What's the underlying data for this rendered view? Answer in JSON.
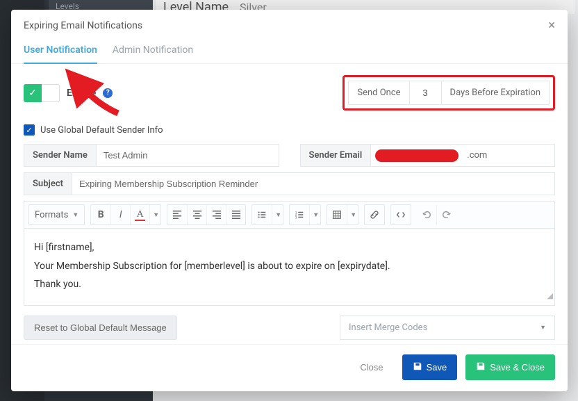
{
  "bg": {
    "levels_item": "Levels",
    "level_name_label": "Level Name",
    "level_name_value": "Silver"
  },
  "modal": {
    "title": "Expiring Email Notifications",
    "close": "×"
  },
  "tabs": {
    "user": "User Notification",
    "admin": "Admin Notification"
  },
  "enable": {
    "label": "Enable"
  },
  "send_once": {
    "label": "Send Once",
    "value": "3",
    "suffix": "Days Before Expiration"
  },
  "global_sender": {
    "checked": true,
    "label": "Use Global Default Sender Info"
  },
  "sender_name": {
    "label": "Sender Name",
    "value": "Test Admin"
  },
  "sender_email": {
    "label": "Sender Email",
    "suffix": ".com"
  },
  "subject": {
    "label": "Subject",
    "value": "Expiring Membership Subscription Reminder"
  },
  "editor": {
    "formats_label": "Formats",
    "body_line1": "Hi [firstname],",
    "body_line2": "Your Membership Subscription for [memberlevel] is about to expire on [expirydate].",
    "body_line3": "Thank you."
  },
  "actions": {
    "reset": "Reset to Global Default Message",
    "merge_placeholder": "Insert Merge Codes"
  },
  "footer": {
    "close": "Close",
    "save": "Save",
    "save_close": "Save & Close"
  }
}
